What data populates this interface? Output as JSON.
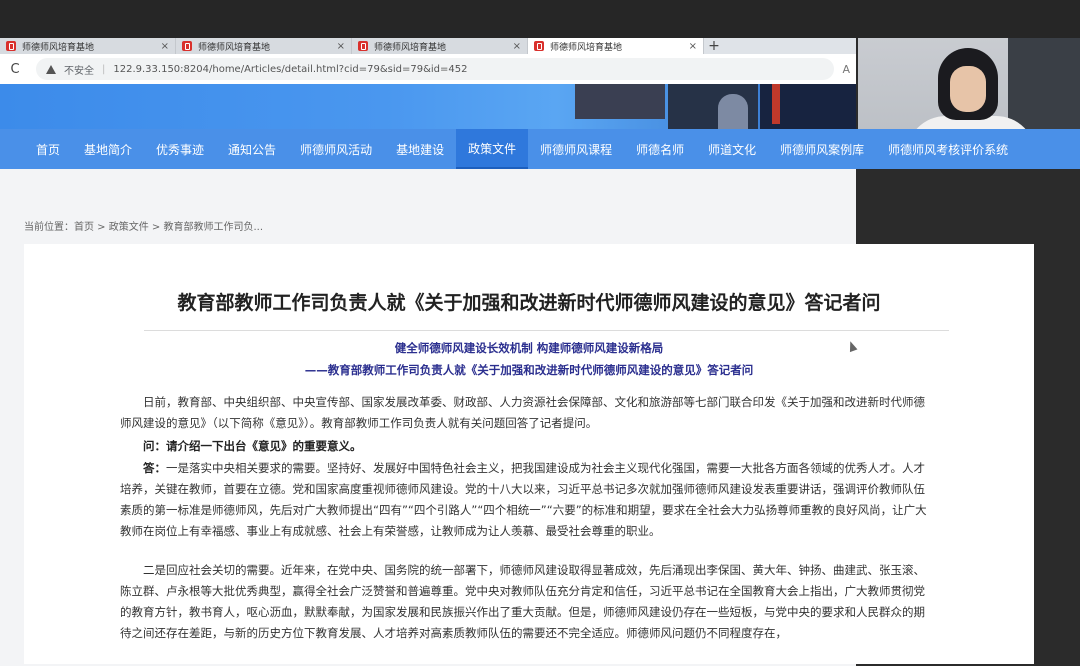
{
  "browser": {
    "tabs": [
      {
        "title": "师德师风培育基地",
        "active": false
      },
      {
        "title": "师德师风培育基地",
        "active": false
      },
      {
        "title": "师德师风培育基地",
        "active": false
      },
      {
        "title": "师德师风培育基地",
        "active": true
      }
    ],
    "close_glyph": "×",
    "new_tab_glyph": "+",
    "reload_glyph": "C",
    "insecure_label": "不安全",
    "separator": "|",
    "url": "122.9.33.150:8204/home/Articles/detail.html?cid=79&sid=79&id=452",
    "reader_glyph": "A"
  },
  "nav": {
    "items": [
      "首页",
      "基地简介",
      "优秀事迹",
      "通知公告",
      "师德师风活动",
      "基地建设",
      "政策文件",
      "师德师风课程",
      "师德名师",
      "师道文化",
      "师德师风案例库",
      "师德师风考核评价系统"
    ],
    "active_index": 6
  },
  "breadcrumb": "当前位置：首页 > 政策文件 > 教育部教师工作司负...",
  "article": {
    "title": "教育部教师工作司负责人就《关于加强和改进新时代师德师风建设的意见》答记者问",
    "subtitle_1": "健全师德师风建设长效机制 构建师德师风建设新格局",
    "subtitle_2": "——教育部教师工作司负责人就《关于加强和改进新时代师德师风建设的意见》答记者问",
    "p1": "日前，教育部、中央组织部、中央宣传部、国家发展改革委、财政部、人力资源社会保障部、文化和旅游部等七部门联合印发《关于加强和改进新时代师德师风建设的意见》（以下简称《意见》）。教育部教师工作司负责人就有关问题回答了记者提问。",
    "q1": "问：请介绍一下出台《意见》的重要意义。",
    "a1_label": "答：",
    "a1": "一是落实中央相关要求的需要。坚持好、发展好中国特色社会主义，把我国建设成为社会主义现代化强国，需要一大批各方面各领域的优秀人才。人才培养，关键在教师，首要在立德。党和国家高度重视师德师风建设。党的十八大以来，习近平总书记多次就加强师德师风建设发表重要讲话，强调评价教师队伍素质的第一标准是师德师风，先后对广大教师提出“四有”“四个引路人”“四个相统一”“六要”的标准和期望，要求在全社会大力弘扬尊师重教的良好风尚，让广大教师在岗位上有幸福感、事业上有成就感、社会上有荣誉感，让教师成为让人羡慕、最受社会尊重的职业。",
    "p2": "二是回应社会关切的需要。近年来，在党中央、国务院的统一部署下，师德师风建设取得显著成效，先后涌现出李保国、黄大年、钟扬、曲建武、张玉滚、陈立群、卢永根等大批优秀典型，赢得全社会广泛赞誉和普遍尊重。党中央对教师队伍充分肯定和信任，习近平总书记在全国教育大会上指出，广大教师贯彻党的教育方针，教书育人，呕心沥血，默默奉献，为国家发展和民族振兴作出了重大贡献。但是，师德师风建设仍存在一些短板，与党中央的要求和人民群众的期待之间还存在差距，与新的历史方位下教育发展、人才培养对高素质教师队伍的需要还不完全适应。师德师风问题仍不同程度存在，"
  },
  "colors": {
    "nav_bg": "#4a90e8",
    "nav_active": "#2f78dc",
    "subtitle": "#2b2f8f"
  }
}
